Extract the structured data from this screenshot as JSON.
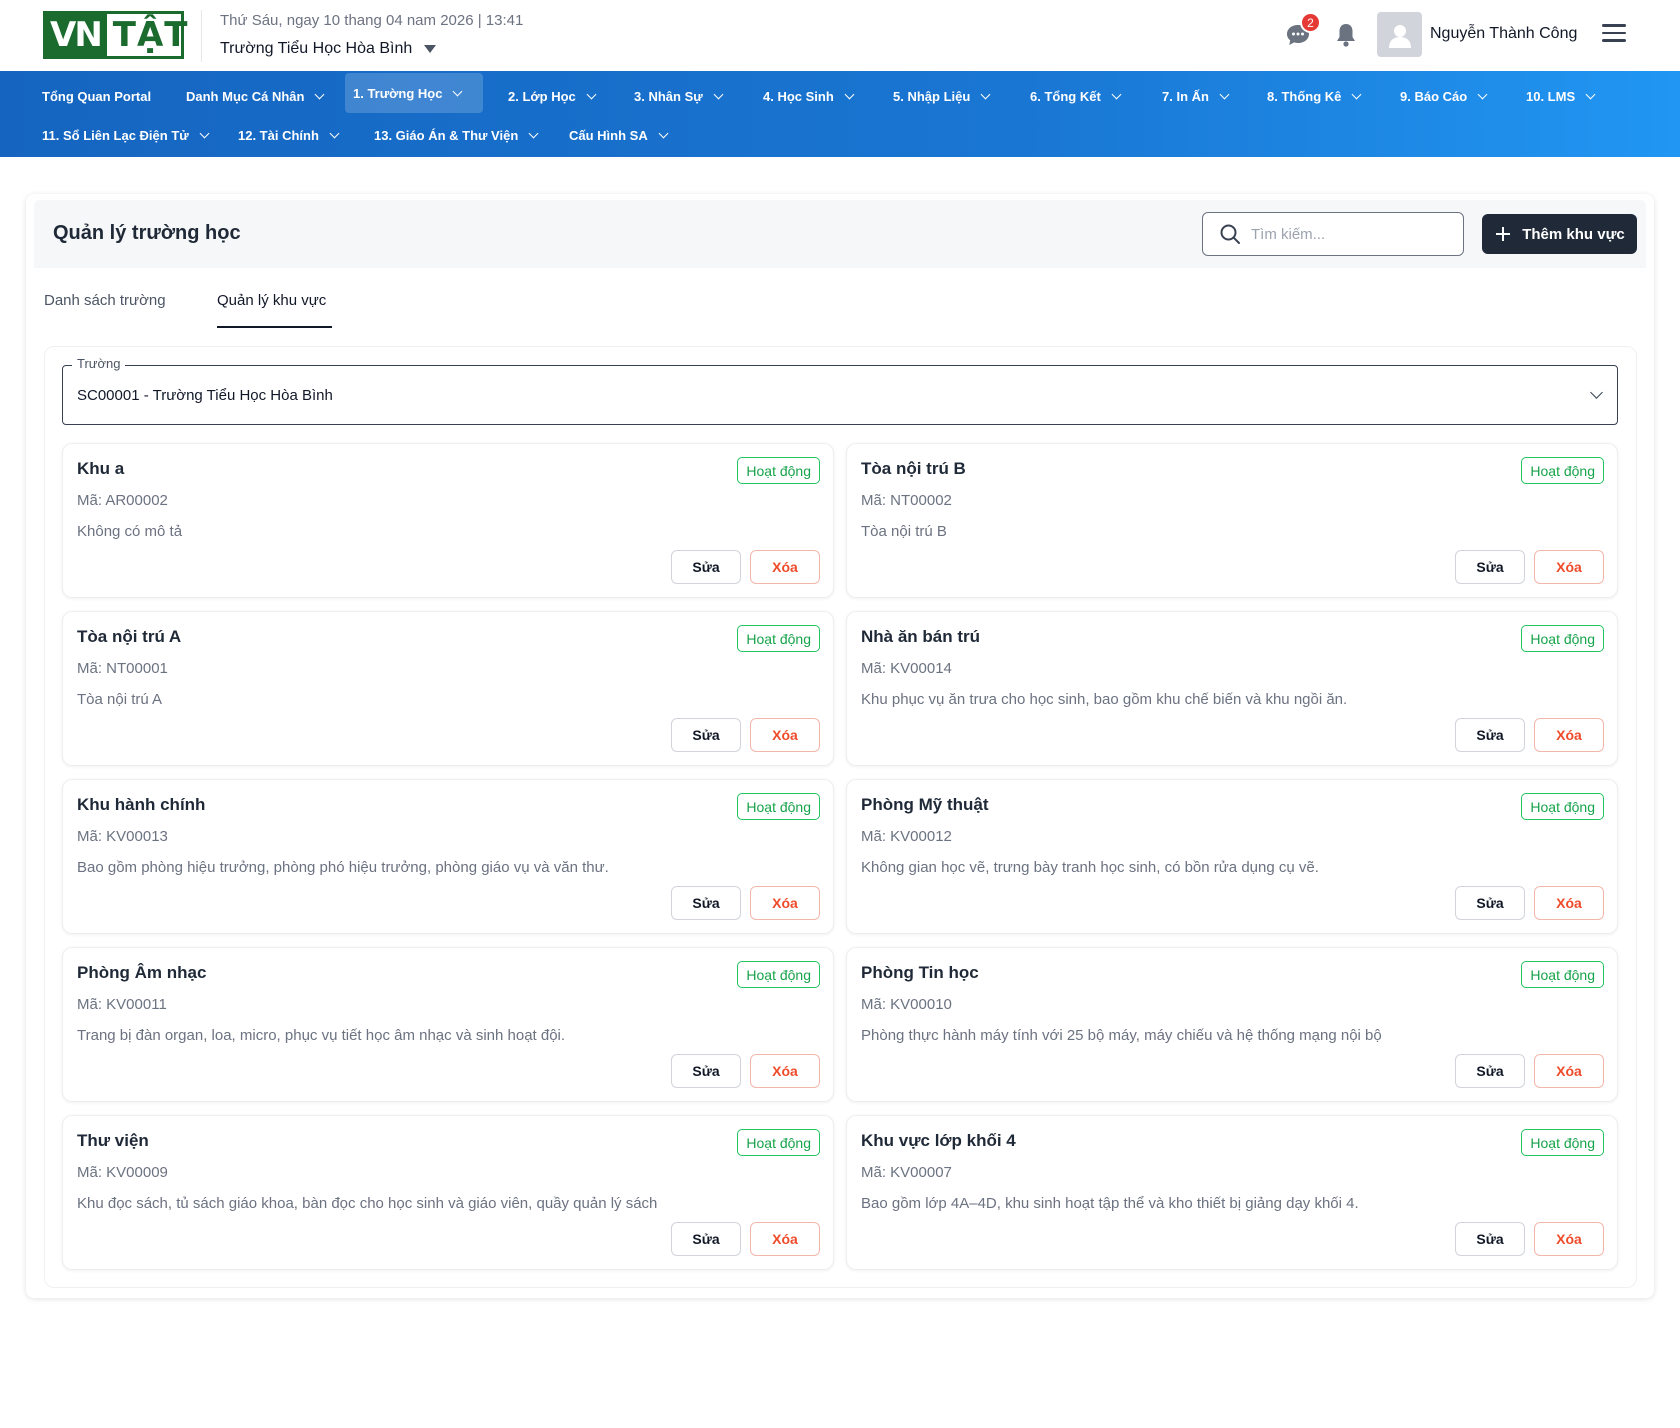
{
  "header": {
    "logo_left": "VN",
    "logo_right": "TẬT",
    "date_text": "Thứ Sáu, ngay 10 thang 04 nam 2026 | 13:41",
    "school": "Trường Tiểu Học Hòa Bình",
    "chat_badge_count": "2",
    "user_name": "Nguyễn Thành Công"
  },
  "nav": {
    "row1": [
      {
        "label": "Tổng Quan Portal",
        "has_caret": false
      },
      {
        "label": "Danh Mục Cá Nhân",
        "has_caret": true
      },
      {
        "label": "1. Trường Học",
        "has_caret": true,
        "active": true
      },
      {
        "label": "2. Lớp Học",
        "has_caret": true
      },
      {
        "label": "3. Nhân Sự",
        "has_caret": true
      },
      {
        "label": "4. Học Sinh",
        "has_caret": true
      },
      {
        "label": "5. Nhập Liệu",
        "has_caret": true
      },
      {
        "label": "6. Tổng Kết",
        "has_caret": true
      },
      {
        "label": "7. In Ấn",
        "has_caret": true
      },
      {
        "label": "8. Thống Kê",
        "has_caret": true
      },
      {
        "label": "9. Báo Cáo",
        "has_caret": true
      },
      {
        "label": "10. LMS",
        "has_caret": true
      }
    ],
    "row2": [
      {
        "label": "11. Sổ Liên Lạc Điện Tử",
        "has_caret": true
      },
      {
        "label": "12. Tài Chính",
        "has_caret": true
      },
      {
        "label": "13. Giáo Án & Thư Viện",
        "has_caret": true
      },
      {
        "label": "Cấu Hình SA",
        "has_caret": true
      }
    ]
  },
  "page": {
    "title": "Quản lý trường học",
    "search_placeholder": "Tìm kiếm...",
    "add_button": "Thêm khu vực",
    "tabs": [
      "Danh sách trường",
      "Quản lý khu vực"
    ],
    "active_tab": 1
  },
  "school_field": {
    "label": "Trường",
    "value": "SC00001 - Trường Tiểu Học Hòa Bình"
  },
  "card_labels": {
    "status": "Hoạt động",
    "edit": "Sửa",
    "delete": "Xóa"
  },
  "areas": [
    {
      "name": "Khu a",
      "code": "Mã: AR00002",
      "desc": "Không có mô tả"
    },
    {
      "name": "Tòa nội trú B",
      "code": "Mã: NT00002",
      "desc": "Tòa nội trú B"
    },
    {
      "name": "Tòa nội trú A",
      "code": "Mã: NT00001",
      "desc": "Tòa nội trú A"
    },
    {
      "name": "Nhà ăn bán trú",
      "code": "Mã: KV00014",
      "desc": "Khu phục vụ ăn trưa cho học sinh, bao gồm khu chế biến và khu ngồi ăn."
    },
    {
      "name": "Khu hành chính",
      "code": "Mã: KV00013",
      "desc": "Bao gồm phòng hiệu trưởng, phòng phó hiệu trưởng, phòng giáo vụ và văn thư."
    },
    {
      "name": "Phòng Mỹ thuật",
      "code": "Mã: KV00012",
      "desc": "Không gian học vẽ, trưng bày tranh học sinh, có bồn rửa dụng cụ vẽ."
    },
    {
      "name": "Phòng Âm nhạc",
      "code": "Mã: KV00011",
      "desc": "Trang bị đàn organ, loa, micro, phục vụ tiết học âm nhạc và sinh hoạt đội."
    },
    {
      "name": "Phòng Tin học",
      "code": "Mã: KV00010",
      "desc": "Phòng thực hành máy tính với 25 bộ máy, máy chiếu và hệ thống mạng nội bộ"
    },
    {
      "name": "Thư viện",
      "code": "Mã: KV00009",
      "desc": "Khu đọc sách, tủ sách giáo khoa, bàn đọc cho học sinh và giáo viên, quầy quản lý sách"
    },
    {
      "name": "Khu vực lớp khối 4",
      "code": "Mã: KV00007",
      "desc": "Bao gồm lớp 4A–4D, khu sinh hoạt tập thể và kho thiết bị giảng dạy khối 4."
    }
  ],
  "colors": {
    "brand_green": "#1b6b2f",
    "nav_blue": "#1976d2",
    "status_green": "#16a34a",
    "danger": "#ef4b2a",
    "primary_dark": "#1f2937"
  },
  "icons": [
    "chat-icon",
    "bell-icon",
    "user-avatar-icon",
    "hamburger-menu-icon",
    "search-icon",
    "plus-icon",
    "chevron-down-icon"
  ]
}
